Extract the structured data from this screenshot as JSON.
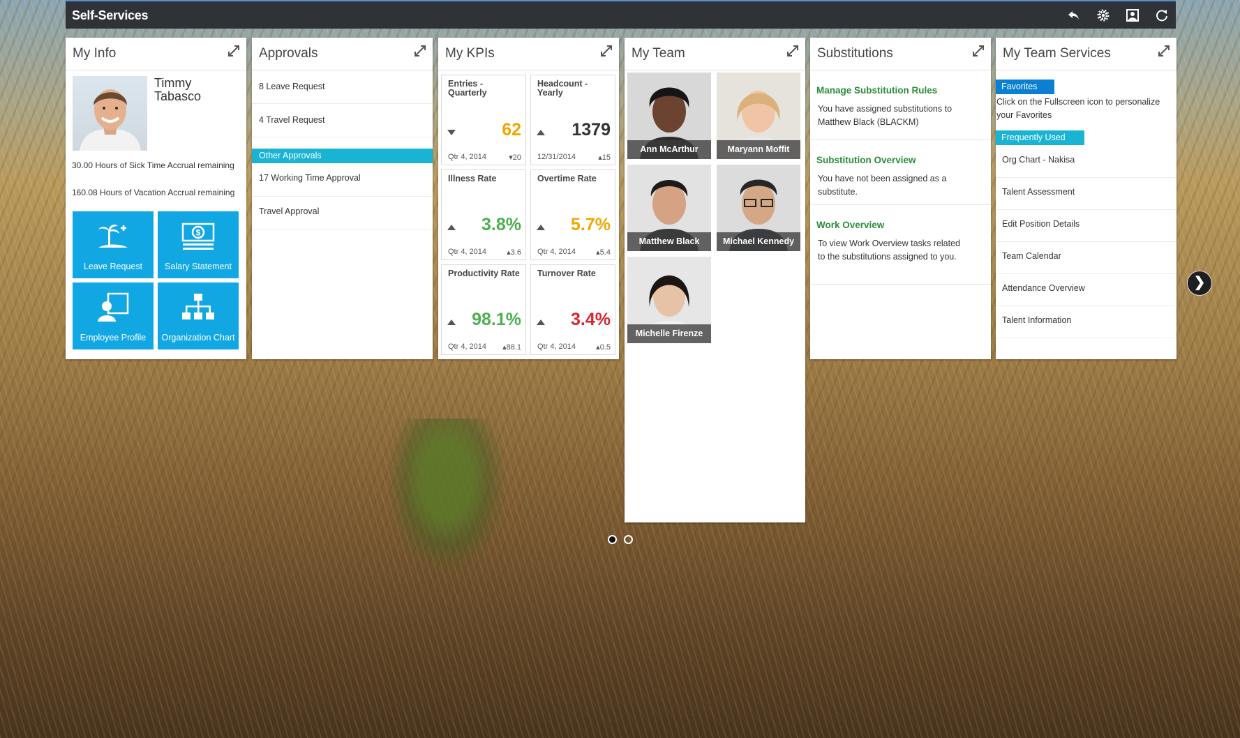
{
  "app": {
    "title": "Self-Services"
  },
  "toolbar": {
    "icons": [
      "back-icon",
      "settings-icon",
      "personalize-icon",
      "refresh-icon"
    ]
  },
  "my_info": {
    "title": "My Info",
    "name": "Timmy Tabasco",
    "sick_time": "30.00 Hours of Sick Time Accrual remaining",
    "vacation": "160.08 Hours of Vacation Accrual remaining",
    "apps": [
      {
        "label": "Leave Request",
        "icon": "palm-tree-icon"
      },
      {
        "label": "Salary Statement",
        "icon": "money-icon"
      },
      {
        "label": "Employee Profile",
        "icon": "profile-icon"
      },
      {
        "label": "Organization Chart",
        "icon": "org-chart-icon"
      }
    ]
  },
  "approvals": {
    "title": "Approvals",
    "items": [
      "8 Leave Request",
      "4 Travel Request"
    ],
    "other_label": "Other Approvals",
    "other_items": [
      "17 Working Time Approval",
      "Travel Approval"
    ]
  },
  "kpis": {
    "title": "My KPIs",
    "cards": [
      {
        "title": "Entries - Quarterly",
        "value": "62",
        "trend": "down",
        "color": "#f0a800",
        "period": "Qtr 4, 2014",
        "delta": "▾20"
      },
      {
        "title": "Headcount - Yearly",
        "value": "1379",
        "trend": "up",
        "color": "#333333",
        "period": "12/31/2014",
        "delta": "▴15"
      },
      {
        "title": "Illness Rate",
        "value": "3.8%",
        "trend": "up",
        "color": "#4caf50",
        "period": "Qtr 4, 2014",
        "delta": "▴3.6"
      },
      {
        "title": "Overtime Rate",
        "value": "5.7%",
        "trend": "up",
        "color": "#f0a800",
        "period": "Qtr 4, 2014",
        "delta": "▴5.4"
      },
      {
        "title": "Productivity Rate",
        "value": "98.1%",
        "trend": "up",
        "color": "#4caf50",
        "period": "Qtr 4, 2014",
        "delta": "▴88.1"
      },
      {
        "title": "Turnover Rate",
        "value": "3.4%",
        "trend": "up",
        "color": "#d9252f",
        "period": "Qtr 4, 2014",
        "delta": "▴0.5"
      }
    ]
  },
  "team": {
    "title": "My Team",
    "members": [
      "Ann McArthur",
      "Maryann Moffit",
      "Matthew Black",
      "Michael Kennedy",
      "Michelle Firenze"
    ]
  },
  "substitutions": {
    "title": "Substitutions",
    "blocks": [
      {
        "title": "Manage Substitution Rules",
        "text": "You have assigned substitutions to Matthew Black (BLACKM)"
      },
      {
        "title": "Substitution Overview",
        "text": "You have not been assigned as a substitute."
      },
      {
        "title": "Work Overview",
        "text": "To view Work Overview tasks related to the substitutions assigned to you."
      }
    ]
  },
  "team_services": {
    "title": "My Team Services",
    "favorites_label": "Favorites",
    "favorites_hint": "Click on the Fullscreen icon to personalize your Favorites",
    "frequent_label": "Frequently Used",
    "items": [
      "Org Chart - Nakisa",
      "Talent Assessment",
      "Edit Position Details",
      "Team Calendar",
      "Attendance Overview",
      "Talent Information"
    ]
  },
  "colors": {
    "tile_blue": "#11a7e3",
    "section_cyan": "#19b3d3",
    "favorites_blue": "#0b7fd1",
    "link_green": "#2d8c3a"
  },
  "pager": {
    "pages": 2,
    "current": 1
  }
}
